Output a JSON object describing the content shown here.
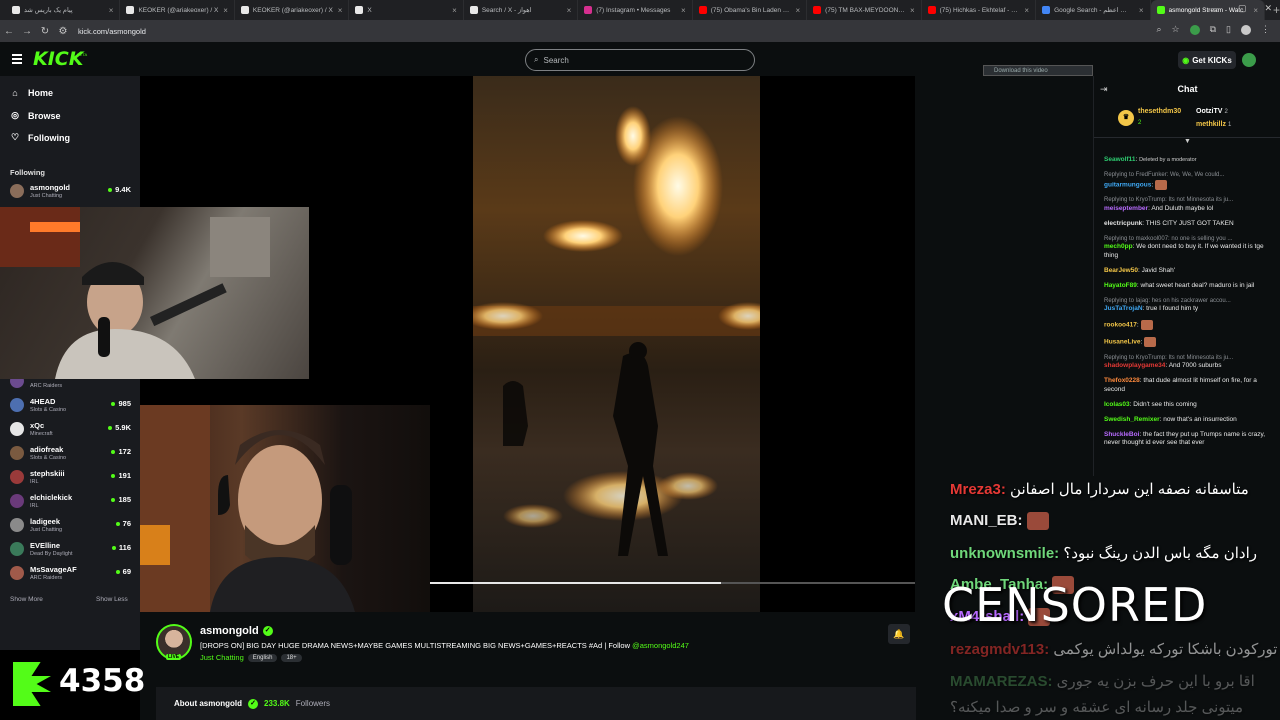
{
  "browser": {
    "tabs": [
      {
        "label": "پیام یک باریس شد",
        "color": "#e8e8e8"
      },
      {
        "label": "KEOKER (@ariakeoxer) / X",
        "color": "#e8e8e8"
      },
      {
        "label": "KEOKER (@ariakeoxer) / X",
        "color": "#e8e8e8"
      },
      {
        "label": "X",
        "color": "#e8e8e8"
      },
      {
        "label": "Search / X - اهواز",
        "color": "#e8e8e8"
      },
      {
        "label": "(7) Instagram • Messages",
        "color": "#d62f8f"
      },
      {
        "label": "(75) Obama's Bin Laden & Tr",
        "color": "#ff0000"
      },
      {
        "label": "(75) TM BAX-MEYDOON OFF",
        "color": "#ff0000"
      },
      {
        "label": "(75) Hichkas - Ekhtelaf - YouT",
        "color": "#ff0000"
      },
      {
        "label": "Google Search - کسکش اعظم",
        "color": "#4285f4"
      },
      {
        "label": "asmongold Stream - Watc",
        "color": "#53fc18"
      }
    ],
    "url": "kick.com/asmongold",
    "new_tab": "+"
  },
  "header": {
    "logo": "KICK",
    "logo_beta": "BETA",
    "search_placeholder": "Search",
    "get_kicks": "Get KICKs",
    "download_video": "Download this video"
  },
  "sidebar": {
    "nav": [
      {
        "label": "Home",
        "icon": "home-icon"
      },
      {
        "label": "Browse",
        "icon": "compass-icon"
      },
      {
        "label": "Following",
        "icon": "heart-icon"
      }
    ],
    "following_heading": "Following",
    "channels_top": [
      {
        "name": "asmongold",
        "category": "Just Chatting",
        "viewers": "9.4K",
        "avatar": "#8a6d5a"
      }
    ],
    "channels": [
      {
        "name": "",
        "category": "ARC Raiders",
        "viewers": "",
        "avatar": "#6b4b8f"
      },
      {
        "name": "4HEAD",
        "category": "Slots & Casino",
        "viewers": "985",
        "avatar": "#4d6fb0"
      },
      {
        "name": "xQc",
        "category": "Minecraft",
        "viewers": "5.9K",
        "avatar": "#e6e6e6"
      },
      {
        "name": "adiofreak",
        "category": "Slots & Casino",
        "viewers": "172",
        "avatar": "#7a5a40"
      },
      {
        "name": "stephskiii",
        "category": "IRL",
        "viewers": "191",
        "avatar": "#9a3a3a"
      },
      {
        "name": "elchiclekick",
        "category": "IRL",
        "viewers": "185",
        "avatar": "#6a3a7a"
      },
      {
        "name": "ladigeek",
        "category": "Just Chatting",
        "viewers": "76",
        "avatar": "#8a8a8a"
      },
      {
        "name": "EVElline",
        "category": "Dead By Daylight",
        "viewers": "116",
        "avatar": "#3a7a5a"
      },
      {
        "name": "MsSavageAF",
        "category": "ARC Raiders",
        "viewers": "69",
        "avatar": "#a05a4a"
      }
    ],
    "show_more": "Show More",
    "show_less": "Show Less"
  },
  "player": {
    "progress_fraction": 0.6
  },
  "stream": {
    "streamer": "asmongold",
    "live": "LIVE",
    "title_prefix": "[DROPS ON] BIG DAY HUGE DRAMA NEWS+MAYBE GAMES MULTISTREAMING BIG NEWS+GAMES+REACTS #Ad | Follow ",
    "title_tag": "@asmongold247",
    "category": "Just Chatting",
    "tags": [
      "English",
      "18+"
    ],
    "about_prefix": "About asmongold",
    "followers": "233.8K",
    "followers_label": "Followers"
  },
  "kick_counter": "4358",
  "chat": {
    "title": "Chat",
    "gifters": {
      "top": {
        "name": "thesethdm30",
        "count": "2"
      },
      "second": {
        "name": "OotziTV",
        "count": "2"
      },
      "third": {
        "name": "methkillz",
        "count": "1"
      }
    },
    "messages": [
      {
        "reply": "",
        "user": "Seawolf11",
        "color": "#2ecc71",
        "text": "Deleted by a moderator"
      },
      {
        "reply": "Replying to FredFunker: We, We, We could...",
        "user": "guitarmungous",
        "color": "#3fa9f5",
        "text": ""
      },
      {
        "reply": "Replying to KryoTrump: Its not Minnesota its ju...",
        "user": "meiseptember",
        "color": "#b86bff",
        "text": "And Duluth maybe lol"
      },
      {
        "reply": "",
        "user": "electricpunk",
        "color": "#e0e0e0",
        "text": "THIS CITY JUST GOT TAKEN"
      },
      {
        "reply": "Replying to maxkool007: no one is selling you ...",
        "user": "mech0pp",
        "color": "#53fc18",
        "text": "We dont need to buy it. If we wanted it is tge thing"
      },
      {
        "reply": "",
        "user": "BearJew50",
        "color": "#f3c648",
        "text": "Javid Shah'"
      },
      {
        "reply": "",
        "user": "HayatoF89",
        "color": "#53fc18",
        "text": "what sweet heart deal? maduro is in jail"
      },
      {
        "reply": "Replying to lajag: hes on his zackrawer accou...",
        "user": "JusTaTrojaN",
        "color": "#3fa9f5",
        "text": "true I found him ty"
      },
      {
        "reply": "",
        "user": "rookoo417",
        "color": "#f3c648",
        "text": ""
      },
      {
        "reply": "",
        "user": "HusaneLive",
        "color": "#f3c648",
        "text": ""
      },
      {
        "reply": "Replying to KryoTrump: Its not Minnesota its ju...",
        "user": "shadowplaygame34",
        "color": "#e53935",
        "text": "And 7000 suburbs"
      },
      {
        "reply": "",
        "user": "Thefox0228",
        "color": "#ff8a3d",
        "text": "that dude almost lit himself on fire, for a second"
      },
      {
        "reply": "",
        "user": "Icolas03",
        "color": "#53fc18",
        "text": "Didn't see this coming"
      },
      {
        "reply": "",
        "user": "Swedish_Remixer",
        "color": "#53fc18",
        "text": "now that's an insurrection"
      },
      {
        "reply": "",
        "user": "ShuckleBoi",
        "color": "#b86bff",
        "text": "the fact they put up Trumps name is crazy, never thought id ever see that ever"
      }
    ]
  },
  "overlay": {
    "lines": [
      {
        "user": "Mreza3:",
        "color": "#e53935",
        "text": "متاسفانه نصفه این سردارا مال اصفانن",
        "emote": false
      },
      {
        "user": "MANI_EB:",
        "color": "#e8e8e8",
        "text": "",
        "emote": true
      },
      {
        "user": "unknownsmile:",
        "color": "#6fd77a",
        "text": "رادان مگه باس الدن رینگ نبود؟",
        "emote": false
      },
      {
        "user": "Ambe_Tanha:",
        "color": "#6fd77a",
        "text": "",
        "emote": true
      },
      {
        "user": "xM4rshall:",
        "color": "#b86bff",
        "text": "",
        "emote": true
      },
      {
        "user": "rezagmdv113:",
        "color": "#e53935",
        "text": "تورکودن باشکا تورکه یولداش یوکمی",
        "emote": false
      },
      {
        "user": "MAMAREZAS:",
        "color": "#6fd77a",
        "text": "اقا برو با این حرف بزن یه جوری",
        "emote": false
      },
      {
        "user": "",
        "color": "#e8e8e8",
        "text": "میتونی جلد رسانه ای عشقه و سر و صدا میکنه؟",
        "emote": false
      }
    ],
    "censored": "CENSORED"
  }
}
